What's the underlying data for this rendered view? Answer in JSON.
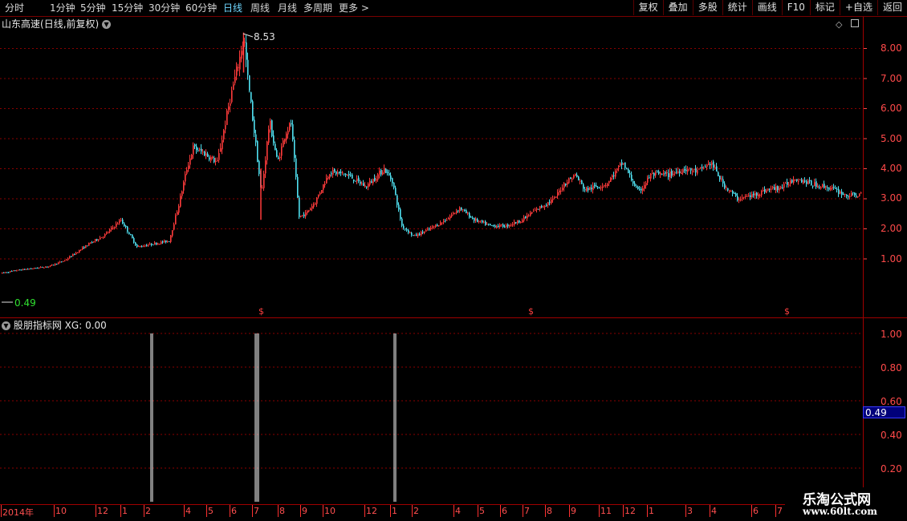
{
  "toolbar": {
    "timeframes": [
      "分时",
      "1分钟",
      "5分钟",
      "15分钟",
      "30分钟",
      "60分钟",
      "日线",
      "周线",
      "月线",
      "多周期",
      "更多"
    ],
    "active_timeframe": "日线",
    "more_arrow": ">",
    "right_buttons": [
      "复权",
      "叠加",
      "多股",
      "统计",
      "画线",
      "F10",
      "标记",
      "+自选",
      "返回"
    ]
  },
  "main_chart": {
    "stock_name": "山东高速",
    "mode": "(日线,前复权)",
    "high_label": "8.53",
    "low_label": "0.49",
    "marker_symbol": "$",
    "y_ticks": [
      "8.00",
      "7.00",
      "6.00",
      "5.00",
      "4.00",
      "3.00",
      "2.00",
      "1.00"
    ],
    "colors": {
      "up": "#ff3b3b",
      "down": "#50e0f0",
      "grid": "#8a0000",
      "axis": "#ff4a4a"
    }
  },
  "sub_chart": {
    "indicator_name": "股朋指标网",
    "xg_label": "XG:",
    "xg_value": "0.00",
    "y_ticks": [
      "1.00",
      "0.80",
      "0.60",
      "0.40",
      "0.20"
    ],
    "current_value": "0.49"
  },
  "date_axis": {
    "labels": [
      "2014年",
      "10",
      "12",
      "1",
      "2",
      "4",
      "5",
      "6",
      "7",
      "8",
      "9",
      "10",
      "12",
      "1",
      "2",
      "4",
      "5",
      "6",
      "7",
      "8",
      "9",
      "11",
      "12",
      "1",
      "3",
      "4",
      "6",
      "7"
    ]
  },
  "watermark": {
    "title": "乐淘公式网",
    "url": "www.60lt.com"
  },
  "chart_data": {
    "type": "candlestick",
    "title": "山东高速 (日线,前复权)",
    "ylim": [
      0.3,
      9.0
    ],
    "price_anchors": [
      [
        0,
        0.52
      ],
      [
        20,
        0.62
      ],
      [
        60,
        0.75
      ],
      [
        80,
        0.95
      ],
      [
        110,
        1.5
      ],
      [
        130,
        1.8
      ],
      [
        150,
        2.3
      ],
      [
        170,
        1.4
      ],
      [
        190,
        1.5
      ],
      [
        210,
        1.6
      ],
      [
        222,
        2.8
      ],
      [
        232,
        4.0
      ],
      [
        240,
        4.7
      ],
      [
        255,
        4.5
      ],
      [
        270,
        4.2
      ],
      [
        285,
        6.2
      ],
      [
        298,
        7.7
      ],
      [
        303,
        8.45
      ],
      [
        308,
        7.0
      ],
      [
        318,
        4.8
      ],
      [
        325,
        3.1
      ],
      [
        335,
        5.6
      ],
      [
        345,
        4.2
      ],
      [
        355,
        5.2
      ],
      [
        362,
        5.5
      ],
      [
        372,
        2.4
      ],
      [
        380,
        2.5
      ],
      [
        392,
        2.9
      ],
      [
        410,
        3.9
      ],
      [
        432,
        3.8
      ],
      [
        455,
        3.4
      ],
      [
        478,
        4.0
      ],
      [
        488,
        3.6
      ],
      [
        500,
        2.1
      ],
      [
        515,
        1.75
      ],
      [
        535,
        2.0
      ],
      [
        555,
        2.3
      ],
      [
        572,
        2.7
      ],
      [
        590,
        2.3
      ],
      [
        610,
        2.1
      ],
      [
        630,
        2.1
      ],
      [
        650,
        2.3
      ],
      [
        665,
        2.6
      ],
      [
        690,
        3.0
      ],
      [
        702,
        3.5
      ],
      [
        716,
        3.8
      ],
      [
        728,
        3.3
      ],
      [
        755,
        3.5
      ],
      [
        775,
        4.2
      ],
      [
        795,
        3.2
      ],
      [
        810,
        3.8
      ],
      [
        832,
        3.8
      ],
      [
        852,
        4.0
      ],
      [
        868,
        3.9
      ],
      [
        885,
        4.2
      ],
      [
        900,
        3.5
      ],
      [
        918,
        3.0
      ],
      [
        935,
        3.1
      ],
      [
        955,
        3.3
      ],
      [
        975,
        3.4
      ],
      [
        990,
        3.7
      ],
      [
        1010,
        3.5
      ],
      [
        1035,
        3.35
      ],
      [
        1055,
        3.1
      ],
      [
        1075,
        3.15
      ]
    ],
    "high_point": 8.53,
    "low_point": 0.49,
    "signal_values": [
      1.0,
      1.0,
      1.0,
      1.0,
      1.0,
      1.0,
      1.0
    ]
  }
}
